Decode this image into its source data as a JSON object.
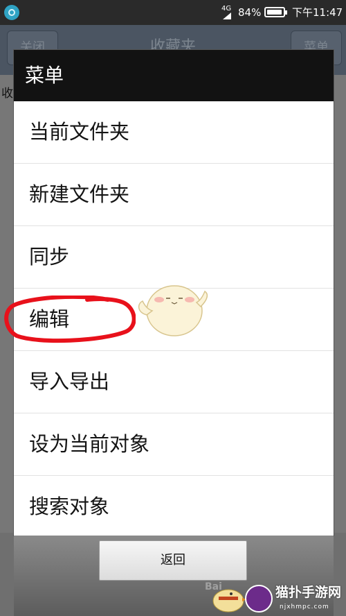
{
  "status_bar": {
    "network_badge": "4G",
    "battery_percent": "84%",
    "battery_level": 0.84,
    "time": "下午11:47",
    "left_icon": "app-notification-icon",
    "signal_icon": "signal-icon",
    "battery_icon": "battery-icon"
  },
  "background_app": {
    "close_label": "关闭",
    "title": "收藏夹",
    "menu_label": "菜单",
    "row_label": "收"
  },
  "dialog": {
    "title": "菜单",
    "items": [
      {
        "label": "当前文件夹"
      },
      {
        "label": "新建文件夹"
      },
      {
        "label": "同步"
      },
      {
        "label": "编辑"
      },
      {
        "label": "导入导出"
      },
      {
        "label": "设为当前对象"
      },
      {
        "label": "搜索对象"
      }
    ],
    "back_label": "返回",
    "annotation": "red-hand-drawn-circle-around-编辑",
    "annotation_color": "#e8111b"
  },
  "watermark": {
    "brand": "猫扑手游网",
    "domain": "njxhmpc.com",
    "baidu_text": "Bai"
  },
  "colors": {
    "status_bar": "#2a2a2a",
    "dialog_title_bar": "#121212",
    "app_header": "#4b5562",
    "logo_purple": "#6c2b8a"
  }
}
